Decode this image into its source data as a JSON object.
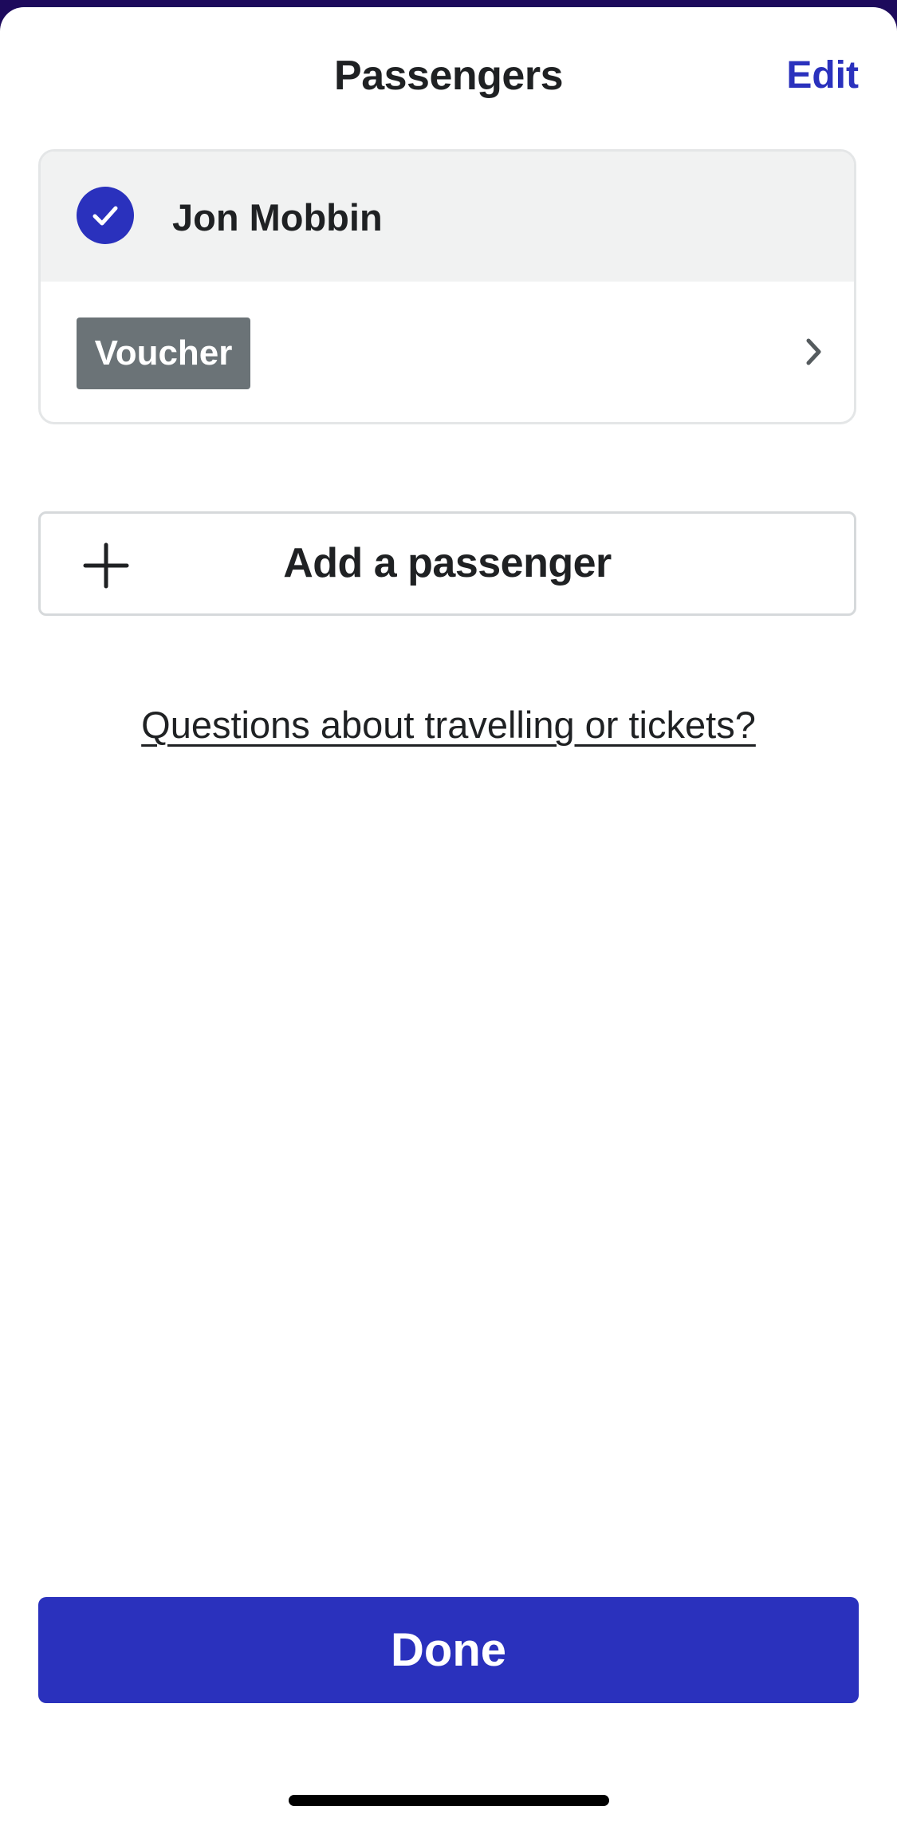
{
  "header": {
    "title": "Passengers",
    "edit_label": "Edit"
  },
  "passenger_card": {
    "name": "Jon Mobbin",
    "selected": true,
    "badge_label": "Voucher"
  },
  "add_passenger": {
    "label": "Add a passenger",
    "icon": "plus-icon"
  },
  "help_link": {
    "label": "Questions about travelling or tickets?"
  },
  "footer": {
    "done_label": "Done"
  },
  "colors": {
    "accent": "#2a31bd",
    "badge": "#6b7377",
    "card_header_bg": "#f1f2f2",
    "text": "#1f2123"
  }
}
